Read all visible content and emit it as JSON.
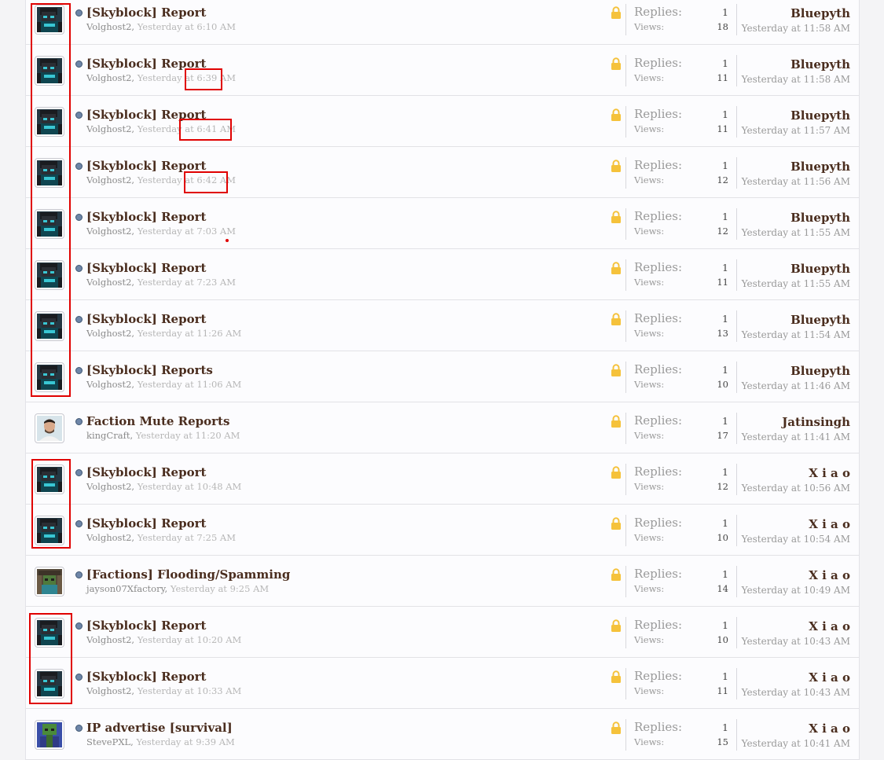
{
  "threads": [
    {
      "title": "[Skyblock] Report",
      "author": "Volghost2",
      "posted": "Yesterday at 6:10 AM",
      "replies_label": "Replies:",
      "replies": "1",
      "views_label": "Views:",
      "views": "18",
      "last_user": "Bluepyth",
      "last_time": "Yesterday at 11:58 AM",
      "avatar": "volghost-skin-icon"
    },
    {
      "title": "[Skyblock] Report",
      "author": "Volghost2",
      "posted": "Yesterday at 6:39 AM",
      "replies_label": "Replies:",
      "replies": "1",
      "views_label": "Views:",
      "views": "11",
      "last_user": "Bluepyth",
      "last_time": "Yesterday at 11:58 AM",
      "avatar": "volghost-skin-icon"
    },
    {
      "title": "[Skyblock] Report",
      "author": "Volghost2",
      "posted": "Yesterday at 6:41 AM",
      "replies_label": "Replies:",
      "replies": "1",
      "views_label": "Views:",
      "views": "11",
      "last_user": "Bluepyth",
      "last_time": "Yesterday at 11:57 AM",
      "avatar": "volghost-skin-icon"
    },
    {
      "title": "[Skyblock] Report",
      "author": "Volghost2",
      "posted": "Yesterday at 6:42 AM",
      "replies_label": "Replies:",
      "replies": "1",
      "views_label": "Views:",
      "views": "12",
      "last_user": "Bluepyth",
      "last_time": "Yesterday at 11:56 AM",
      "avatar": "volghost-skin-icon"
    },
    {
      "title": "[Skyblock] Report",
      "author": "Volghost2",
      "posted": "Yesterday at 7:03 AM",
      "replies_label": "Replies:",
      "replies": "1",
      "views_label": "Views:",
      "views": "12",
      "last_user": "Bluepyth",
      "last_time": "Yesterday at 11:55 AM",
      "avatar": "volghost-skin-icon"
    },
    {
      "title": "[Skyblock] Report",
      "author": "Volghost2",
      "posted": "Yesterday at 7:23 AM",
      "replies_label": "Replies:",
      "replies": "1",
      "views_label": "Views:",
      "views": "11",
      "last_user": "Bluepyth",
      "last_time": "Yesterday at 11:55 AM",
      "avatar": "volghost-skin-icon"
    },
    {
      "title": "[Skyblock] Report",
      "author": "Volghost2",
      "posted": "Yesterday at 11:26 AM",
      "replies_label": "Replies:",
      "replies": "1",
      "views_label": "Views:",
      "views": "13",
      "last_user": "Bluepyth",
      "last_time": "Yesterday at 11:54 AM",
      "avatar": "volghost-skin-icon"
    },
    {
      "title": "[Skyblock] Reports",
      "author": "Volghost2",
      "posted": "Yesterday at 11:06 AM",
      "replies_label": "Replies:",
      "replies": "1",
      "views_label": "Views:",
      "views": "10",
      "last_user": "Bluepyth",
      "last_time": "Yesterday at 11:46 AM",
      "avatar": "volghost-skin-icon"
    },
    {
      "title": "Faction Mute Reports",
      "author": "kingCraft",
      "posted": "Yesterday at 11:20 AM",
      "replies_label": "Replies:",
      "replies": "1",
      "views_label": "Views:",
      "views": "17",
      "last_user": "Jatinsingh",
      "last_time": "Yesterday at 11:41 AM",
      "avatar": "person-photo-icon"
    },
    {
      "title": "[Skyblock] Report",
      "author": "Volghost2",
      "posted": "Yesterday at 10:48 AM",
      "replies_label": "Replies:",
      "replies": "1",
      "views_label": "Views:",
      "views": "12",
      "last_user": "X i a o",
      "last_time": "Yesterday at 10:56 AM",
      "avatar": "volghost-skin-icon"
    },
    {
      "title": "[Skyblock] Report",
      "author": "Volghost2",
      "posted": "Yesterday at 7:25 AM",
      "replies_label": "Replies:",
      "replies": "1",
      "views_label": "Views:",
      "views": "10",
      "last_user": "X i a o",
      "last_time": "Yesterday at 10:54 AM",
      "avatar": "volghost-skin-icon"
    },
    {
      "title": "[Factions] Flooding/Spamming",
      "author": "jayson07Xfactory",
      "posted": "Yesterday at 9:25 AM",
      "replies_label": "Replies:",
      "replies": "1",
      "views_label": "Views:",
      "views": "14",
      "last_user": "X i a o",
      "last_time": "Yesterday at 10:49 AM",
      "avatar": "zombie-skin-icon"
    },
    {
      "title": "[Skyblock] Report",
      "author": "Volghost2",
      "posted": "Yesterday at 10:20 AM",
      "replies_label": "Replies:",
      "replies": "1",
      "views_label": "Views:",
      "views": "10",
      "last_user": "X i a o",
      "last_time": "Yesterday at 10:43 AM",
      "avatar": "volghost-skin-icon"
    },
    {
      "title": "[Skyblock] Report",
      "author": "Volghost2",
      "posted": "Yesterday at 10:33 AM",
      "replies_label": "Replies:",
      "replies": "1",
      "views_label": "Views:",
      "views": "11",
      "last_user": "X i a o",
      "last_time": "Yesterday at 10:43 AM",
      "avatar": "volghost-skin-icon"
    },
    {
      "title": "IP advertise [survival]",
      "author": "StevePXL",
      "posted": "Yesterday at 9:39 AM",
      "replies_label": "Replies:",
      "replies": "1",
      "views_label": "Views:",
      "views": "15",
      "last_user": "X i a o",
      "last_time": "Yesterday at 10:41 AM",
      "avatar": "green-skin-icon"
    }
  ],
  "colors": {
    "title": "#4a2d1e",
    "meta_author": "#8a8a8a",
    "meta_date": "#b7b7b7",
    "annotation": "#e00000",
    "lock": "#f5c23b"
  }
}
